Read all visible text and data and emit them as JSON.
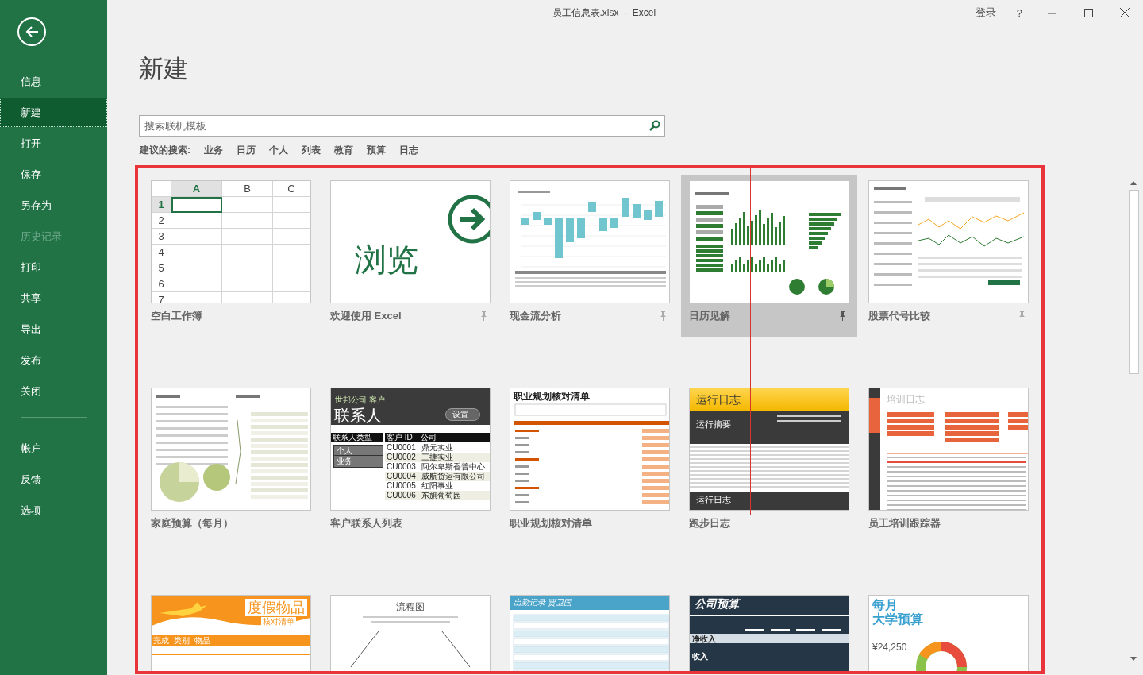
{
  "window": {
    "title": "员工信息表.xlsx  -  Excel",
    "sign_in": "登录",
    "help": "?"
  },
  "sidebar": {
    "items": [
      {
        "label": "信息",
        "selected": false,
        "disabled": false
      },
      {
        "label": "新建",
        "selected": true,
        "disabled": false
      },
      {
        "label": "打开",
        "selected": false,
        "disabled": false
      },
      {
        "label": "保存",
        "selected": false,
        "disabled": false
      },
      {
        "label": "另存为",
        "selected": false,
        "disabled": false
      },
      {
        "label": "历史记录",
        "selected": false,
        "disabled": true
      },
      {
        "label": "打印",
        "selected": false,
        "disabled": false
      },
      {
        "label": "共享",
        "selected": false,
        "disabled": false
      },
      {
        "label": "导出",
        "selected": false,
        "disabled": false
      },
      {
        "label": "发布",
        "selected": false,
        "disabled": false
      },
      {
        "label": "关闭",
        "selected": false,
        "disabled": false
      }
    ],
    "footer_items": [
      {
        "label": "帐户",
        "selected": false,
        "disabled": false
      },
      {
        "label": "反馈",
        "selected": false,
        "disabled": false
      },
      {
        "label": "选项",
        "selected": false,
        "disabled": false
      }
    ]
  },
  "page_title": "新建",
  "search": {
    "placeholder": "搜索联机模板"
  },
  "suggested": {
    "label": "建议的搜索:",
    "terms": [
      "业务",
      "日历",
      "个人",
      "列表",
      "教育",
      "预算",
      "日志"
    ]
  },
  "templates": [
    {
      "name": "空白工作簿",
      "pinned": false,
      "selected": false,
      "thumb": {
        "kind": "sheet",
        "columns": [
          "A",
          "B",
          "C"
        ],
        "rows": [
          "1",
          "2",
          "3",
          "4",
          "5",
          "6",
          "7"
        ]
      }
    },
    {
      "name": "欢迎使用 Excel",
      "pinned": true,
      "selected": false,
      "thumb": {
        "kind": "browse",
        "text": "浏览"
      }
    },
    {
      "name": "现金流分析",
      "pinned": true,
      "selected": false,
      "thumb": {
        "kind": "waterfall"
      }
    },
    {
      "name": "日历见解",
      "pinned": true,
      "selected": true,
      "thumb": {
        "kind": "dashboard"
      }
    },
    {
      "name": "股票代号比较",
      "pinned": true,
      "selected": false,
      "thumb": {
        "kind": "lines"
      }
    },
    {
      "name": "家庭预算（每月）",
      "pinned": false,
      "selected": false,
      "thumb": {
        "kind": "pies"
      }
    },
    {
      "name": "客户联系人列表",
      "pinned": false,
      "selected": false,
      "thumb": {
        "kind": "contacts",
        "company": "世邦公司 客户",
        "title": "联系人",
        "button": "设置",
        "filter_title": "联系人类型",
        "filters": [
          "个人",
          "业务"
        ],
        "columns": [
          "客户 ID",
          "公司"
        ],
        "rows": [
          [
            "CU0001",
            "鼎元实业"
          ],
          [
            "CU0002",
            "三捷实业"
          ],
          [
            "CU0003",
            "阿尔卑斯香普中心"
          ],
          [
            "CU0004",
            "威航货运有限公司"
          ],
          [
            "CU0005",
            "红阳事业"
          ],
          [
            "CU0006",
            "东旗葡萄园"
          ]
        ]
      }
    },
    {
      "name": "职业规划核对清单",
      "pinned": false,
      "selected": false,
      "thumb": {
        "kind": "checklist",
        "title": "职业规划核对清单"
      }
    },
    {
      "name": "跑步日志",
      "pinned": false,
      "selected": false,
      "thumb": {
        "kind": "runlog",
        "title": "运行日志",
        "summary": "运行摘要",
        "footer": "运行日志"
      }
    },
    {
      "name": "员工培训跟踪器",
      "pinned": false,
      "selected": false,
      "thumb": {
        "kind": "training",
        "title": "培训日志"
      }
    },
    {
      "pinned": false,
      "selected": false,
      "thumb": {
        "kind": "vacation",
        "title": "度假物品",
        "subtitle": "核对清单",
        "columns": [
          "完成",
          "类别",
          "物品"
        ]
      }
    },
    {
      "pinned": false,
      "selected": false,
      "thumb": {
        "kind": "flow",
        "title": "流程图"
      }
    },
    {
      "pinned": false,
      "selected": false,
      "thumb": {
        "kind": "attendance",
        "title": "出勤记录  贾卫国"
      }
    },
    {
      "pinned": false,
      "selected": false,
      "thumb": {
        "kind": "budget",
        "title": "公司预算",
        "rows": [
          "净收入",
          "收入"
        ]
      }
    },
    {
      "pinned": false,
      "selected": false,
      "thumb": {
        "kind": "college",
        "title": "每月",
        "subtitle": "大学预算",
        "amount": "¥24,250"
      }
    }
  ]
}
